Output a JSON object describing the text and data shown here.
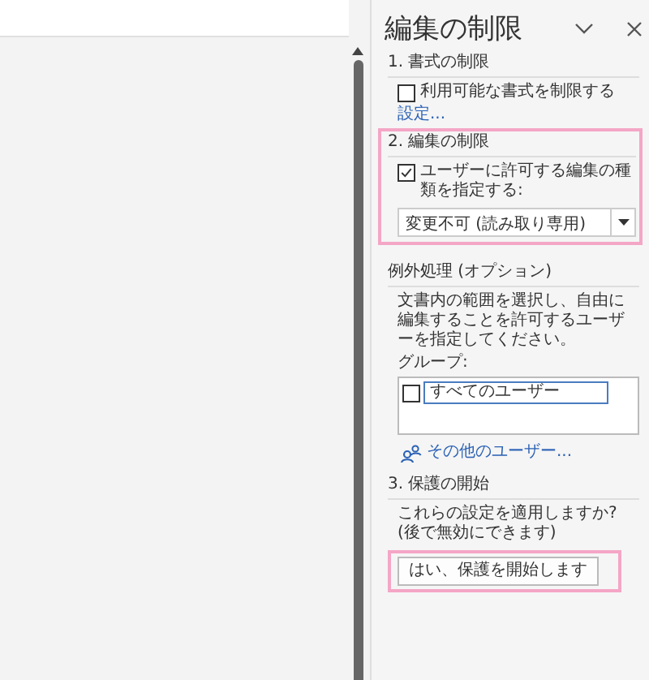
{
  "pane": {
    "title": "編集の制限",
    "formatting": {
      "heading": "1. 書式の制限",
      "checkbox": {
        "label": "利用可能な書式を制限する",
        "checked": false
      },
      "link": "設定...",
      "highlighted": false
    },
    "editing": {
      "heading": "2. 編集の制限",
      "checkbox": {
        "label": "ユーザーに許可する編集の種類を指定する:",
        "checked": true
      },
      "dropdown": {
        "value": "変更不可 (読み取り専用)"
      },
      "highlighted": true
    },
    "exceptions": {
      "heading": "例外処理 (オプション)",
      "description": "文書内の範囲を選択し、自由に編集することを許可するユーザーを指定してください。",
      "group_label": "グループ:",
      "groups": [
        {
          "label": "すべてのユーザー",
          "checked": false
        }
      ],
      "more_users": "その他のユーザー..."
    },
    "start": {
      "heading": "3. 保護の開始",
      "question": "これらの設定を適用しますか? (後で無効にできます)",
      "button": "はい、保護を開始します",
      "highlighted": true
    }
  }
}
